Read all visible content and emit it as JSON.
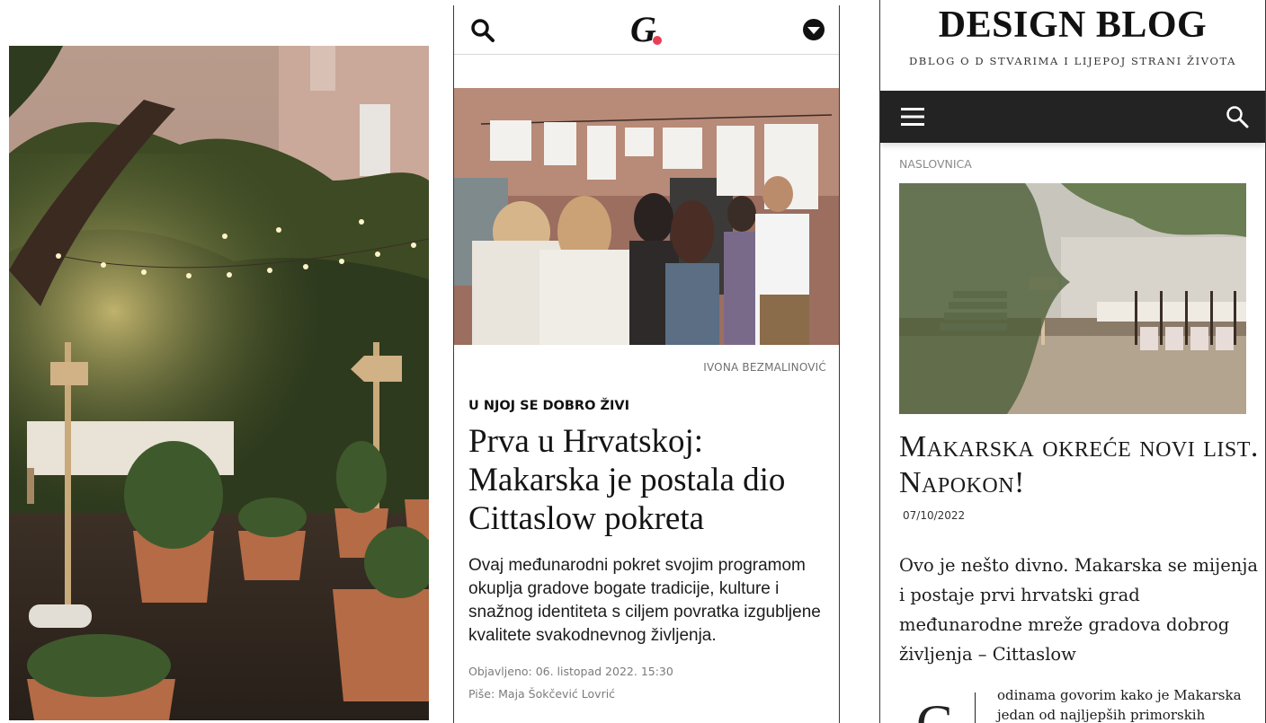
{
  "article": {
    "photo_credit": "IVONA BEZMALINOVIĆ",
    "kicker": "U NJOJ SE DOBRO ŽIVI",
    "title": "Prva u Hrvatskoj: Makarska je postala dio Cittaslow pokreta",
    "lead": "Ovaj međunarodni pokret svojim programom okuplja gradove bogate tradicije, kulture i snažnog identiteta s ciljem povratka izgubljene kvalitete svakodnevnog življenja.",
    "published": "Objavljeno: 06. listopad 2022. 15:30",
    "author": "Piše: Maja Šokčević Lovrić",
    "logo": "G",
    "accent_color": "#ea3e57"
  },
  "blog": {
    "title": "DESIGN BLOG",
    "tagline": "DBLOG O D STVARIMA I LIJEPOJ STRANI ŽIVOTA",
    "breadcrumb": "NASLOVNICA",
    "heading": "Makarska okreće novi list. Napokon!",
    "date": "07/10/2022",
    "lead": "Ovo je nešto divno. Makarska se mijenja i postaje prvi hrvatski grad međunarodne mreže gradova dobrog življenja – Cittaslow",
    "dropcap": "G",
    "body_start": "odinama govorim kako je Makarska jedan od najljepših primorskih",
    "nav_color": "#232323"
  },
  "icons": {
    "left_search": "search-icon",
    "left_menu": "chevron-down-circle-icon",
    "right_menu": "hamburger-menu-icon",
    "right_search": "search-icon"
  }
}
